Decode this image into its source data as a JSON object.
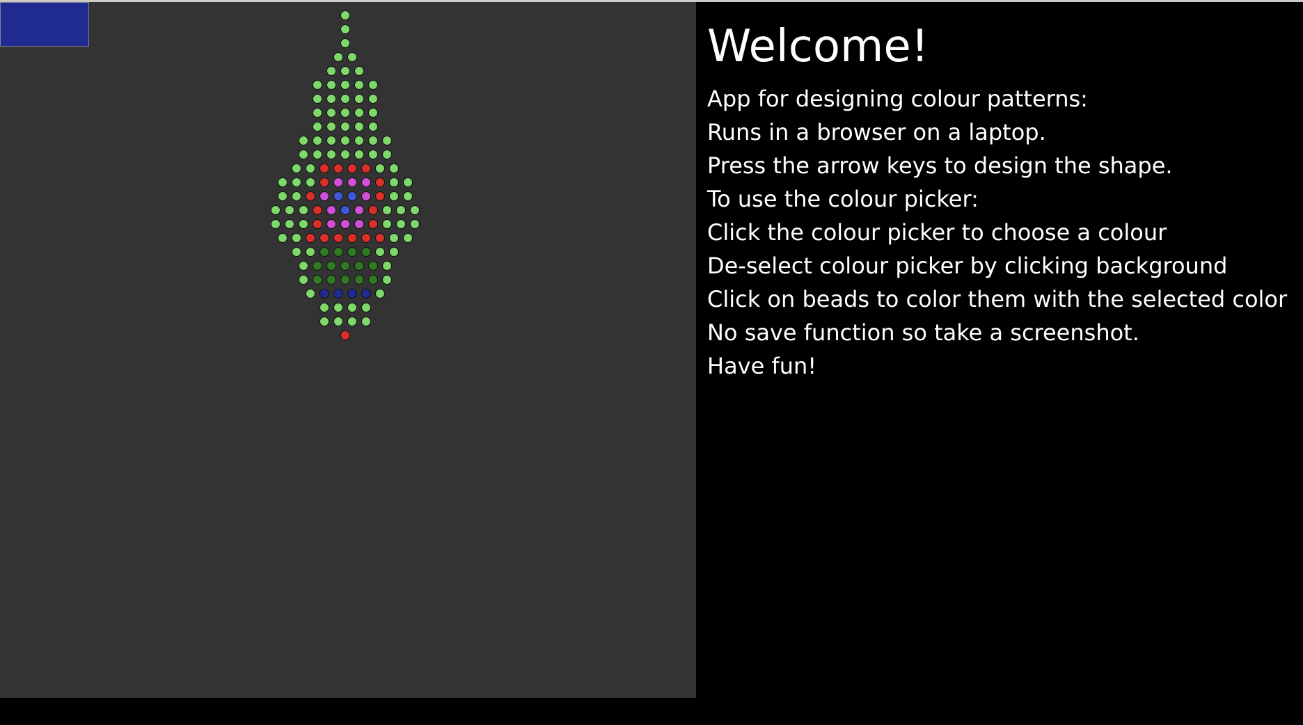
{
  "info": {
    "title": "Welcome!",
    "lines": [
      "App for designing colour patterns:",
      "Runs in a browser on a laptop.",
      "Press the arrow keys to design the shape.",
      "To use the colour picker:",
      "Click the colour picker to choose a colour",
      "De-select colour picker by clicking background",
      "Click on beads to color them with the selected color",
      "No save function so take a screenshot.",
      "Have fun!"
    ]
  },
  "colour_picker": {
    "selected_colour": "#1f2b91"
  },
  "palette": {
    "light_green": "#7ed96a",
    "red": "#d9302a",
    "magenta": "#d24fd8",
    "blue": "#3f58d9",
    "dark_green": "#2f7a22",
    "dark_blue": "#1f2b91"
  },
  "bead_pattern": [
    "g",
    "g",
    "g",
    "gg",
    "ggg",
    "ggggg",
    "ggggg",
    "ggggg",
    "ggggg",
    "ggggggg",
    "ggggggg",
    "ggrrrrgg",
    "gggrmmmrgg",
    "ggrmbbmrgg",
    "gggrmbmrggg",
    "gggrmmmrggg",
    "ggrrrrrrgg",
    "ggddddgg",
    "gdddddg",
    "gdddddg",
    "gLLLLg",
    "gggg",
    "gggg",
    "r"
  ]
}
